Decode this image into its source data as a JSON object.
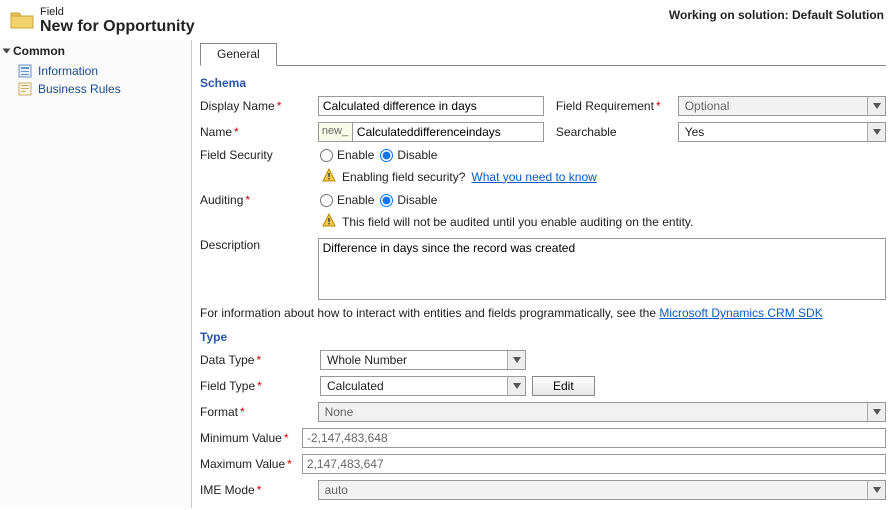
{
  "header": {
    "small": "Field",
    "title": "New for Opportunity",
    "right": "Working on solution: Default Solution"
  },
  "sidebar": {
    "section": "Common",
    "items": [
      "Information",
      "Business Rules"
    ]
  },
  "tabs": {
    "general": "General"
  },
  "sections": {
    "schema": "Schema",
    "type": "Type"
  },
  "schema": {
    "display_name_label": "Display Name",
    "display_name": "Calculated difference in days",
    "field_req_label": "Field Requirement",
    "field_req_value": "Optional",
    "name_label": "Name",
    "name_prefix": "new_",
    "name_value": "Calculateddifferenceindays",
    "searchable_label": "Searchable",
    "searchable_value": "Yes",
    "field_security_label": "Field Security",
    "enable": "Enable",
    "disable": "Disable",
    "security_warn_text": "Enabling field security?",
    "security_link": "What you need to know",
    "auditing_label": "Auditing",
    "audit_warn": "This field will not be audited until you enable auditing on the entity.",
    "description_label": "Description",
    "description": "Difference in days since the record was created"
  },
  "info_text_prefix": "For information about how to interact with entities and fields programmatically, see the ",
  "info_link": "Microsoft Dynamics CRM SDK",
  "type": {
    "data_type_label": "Data Type",
    "data_type": "Whole Number",
    "field_type_label": "Field Type",
    "field_type": "Calculated",
    "edit": "Edit",
    "format_label": "Format",
    "format": "None",
    "min_label": "Minimum Value",
    "min": "-2,147,483,648",
    "max_label": "Maximum Value",
    "max": "2,147,483,647",
    "ime_label": "IME Mode",
    "ime": "auto"
  }
}
